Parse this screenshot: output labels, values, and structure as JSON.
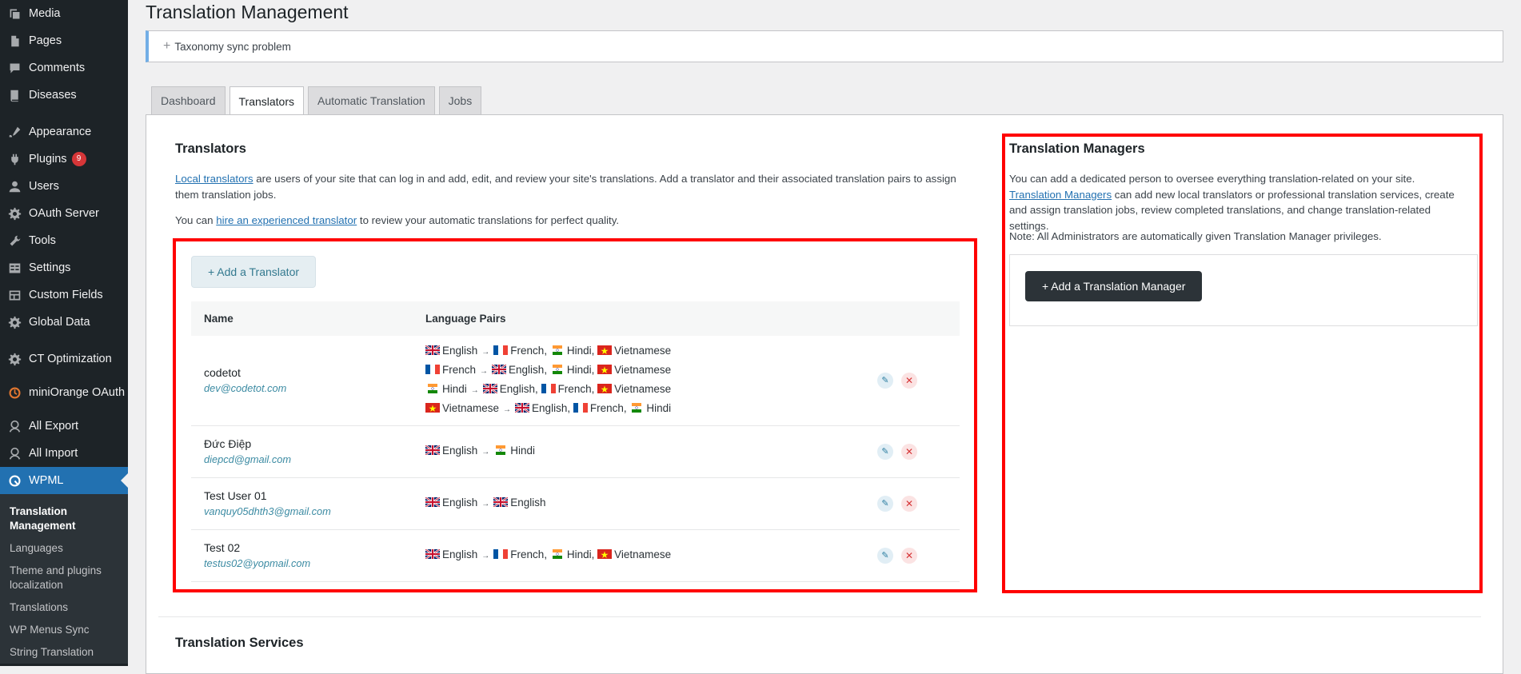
{
  "sidebar": {
    "items": [
      {
        "label": "Media",
        "icon": "media-icon"
      },
      {
        "label": "Pages",
        "icon": "pages-icon"
      },
      {
        "label": "Comments",
        "icon": "comments-icon"
      },
      {
        "label": "Diseases",
        "icon": "book-icon"
      },
      {
        "label": "Appearance",
        "icon": "appearance-icon"
      },
      {
        "label": "Plugins",
        "icon": "plugins-icon",
        "badge": "9"
      },
      {
        "label": "Users",
        "icon": "users-icon"
      },
      {
        "label": "OAuth Server",
        "icon": "gear-icon"
      },
      {
        "label": "Tools",
        "icon": "tools-icon"
      },
      {
        "label": "Settings",
        "icon": "settings-icon"
      },
      {
        "label": "Custom Fields",
        "icon": "table-icon"
      },
      {
        "label": "Global Data",
        "icon": "gear-icon"
      },
      {
        "label": "CT Optimization",
        "icon": "gear-icon"
      },
      {
        "label": "miniOrange OAuth",
        "icon": "orange-logo-icon"
      },
      {
        "label": "All Export",
        "icon": "export-icon"
      },
      {
        "label": "All Import",
        "icon": "import-icon"
      },
      {
        "label": "WPML",
        "icon": "wpml-icon"
      }
    ],
    "submenu": [
      "Translation Management",
      "Languages",
      "Theme and plugins localization",
      "Translations",
      "WP Menus Sync",
      "String Translation"
    ]
  },
  "page": {
    "title": "Translation Management",
    "notice": "Taxonomy sync problem"
  },
  "tabs": [
    "Dashboard",
    "Translators",
    "Automatic Translation",
    "Jobs"
  ],
  "translators": {
    "title": "Translators",
    "intro_link": "Local translators",
    "intro_rest": " are users of your site that can log in and add, edit, and review your site's translations. Add a translator and their associated translation pairs to assign them translation jobs.",
    "hire_pre": "You can ",
    "hire_link": "hire an experienced translator",
    "hire_post": " to review your automatic translations for perfect quality.",
    "add_button": "+ Add a Translator",
    "columns": {
      "name": "Name",
      "pairs": "Language Pairs"
    },
    "rows": [
      {
        "name": "codetot",
        "email": "dev@codetot.com",
        "pairs": [
          {
            "from": "English",
            "from_flag": "uk",
            "to": [
              {
                "lang": "French",
                "flag": "fr"
              },
              {
                "lang": "Hindi",
                "flag": "in"
              },
              {
                "lang": "Vietnamese",
                "flag": "vn"
              }
            ]
          },
          {
            "from": "French",
            "from_flag": "fr",
            "to": [
              {
                "lang": "English",
                "flag": "uk"
              },
              {
                "lang": "Hindi",
                "flag": "in"
              },
              {
                "lang": "Vietnamese",
                "flag": "vn"
              }
            ]
          },
          {
            "from": "Hindi",
            "from_flag": "in",
            "to": [
              {
                "lang": "English",
                "flag": "uk"
              },
              {
                "lang": "French",
                "flag": "fr"
              },
              {
                "lang": "Vietnamese",
                "flag": "vn"
              }
            ]
          },
          {
            "from": "Vietnamese",
            "from_flag": "vn",
            "to": [
              {
                "lang": "English",
                "flag": "uk"
              },
              {
                "lang": "French",
                "flag": "fr"
              },
              {
                "lang": "Hindi",
                "flag": "in"
              }
            ]
          }
        ]
      },
      {
        "name": "Đức Điệp",
        "email": "diepcd@gmail.com",
        "pairs": [
          {
            "from": "English",
            "from_flag": "uk",
            "to": [
              {
                "lang": "Hindi",
                "flag": "in"
              }
            ]
          }
        ]
      },
      {
        "name": "Test User 01",
        "email": "vanquy05dhth3@gmail.com",
        "pairs": [
          {
            "from": "English",
            "from_flag": "uk",
            "to": [
              {
                "lang": "English",
                "flag": "uk"
              }
            ]
          }
        ]
      },
      {
        "name": "Test 02",
        "email": "testus02@yopmail.com",
        "pairs": [
          {
            "from": "English",
            "from_flag": "uk",
            "to": [
              {
                "lang": "French",
                "flag": "fr"
              },
              {
                "lang": "Hindi",
                "flag": "in"
              },
              {
                "lang": "Vietnamese",
                "flag": "vn"
              }
            ]
          }
        ]
      }
    ]
  },
  "managers": {
    "title": "Translation Managers",
    "desc_pre": "You can add a dedicated person to oversee everything translation-related on your site. ",
    "desc_link": "Translation Managers",
    "desc_post": " can add new local translators or professional translation services, create and assign translation jobs, review completed translations, and change translation-related settings.",
    "note": "Note: All Administrators are automatically given Translation Manager privileges.",
    "add_button": "+ Add a Translation Manager"
  },
  "services": {
    "title": "Translation Services"
  },
  "colors": {
    "highlight_box": "#ff0000",
    "wp_blue": "#2271b1",
    "sidebar_bg": "#1d2327"
  }
}
